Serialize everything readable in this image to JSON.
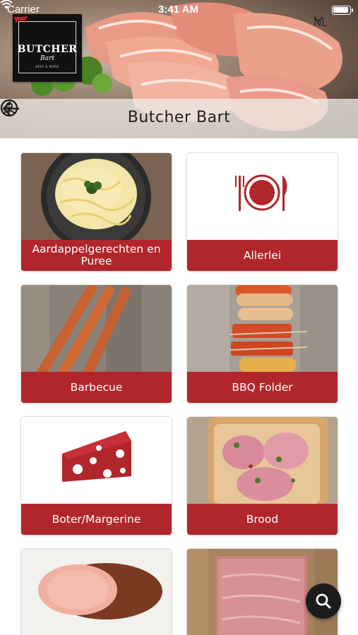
{
  "status_bar": {
    "carrier": "Carrier",
    "time": "3:41 AM"
  },
  "header": {
    "language": "NL",
    "title": "Butcher Bart",
    "logo": {
      "name": "BUTCHER",
      "sub": "Bart",
      "tag": "BEEF & MORE"
    }
  },
  "categories": [
    {
      "label": "Aardappelgerechten en Puree",
      "image": "mashed-potato-dish"
    },
    {
      "label": "Allerlei",
      "image": "plate-cutlery-icon"
    },
    {
      "label": "Barbecue",
      "image": "sausages"
    },
    {
      "label": "BBQ Folder",
      "image": "bbq-skewers"
    },
    {
      "label": "Boter/Margerine",
      "image": "cheese-icon"
    },
    {
      "label": "Brood",
      "image": "pizza-bread"
    },
    {
      "label": "",
      "image": "ham"
    },
    {
      "label": "",
      "image": "sliced-meat"
    }
  ],
  "colors": {
    "accent": "#b1262b",
    "fab": "#1c1c1c"
  }
}
